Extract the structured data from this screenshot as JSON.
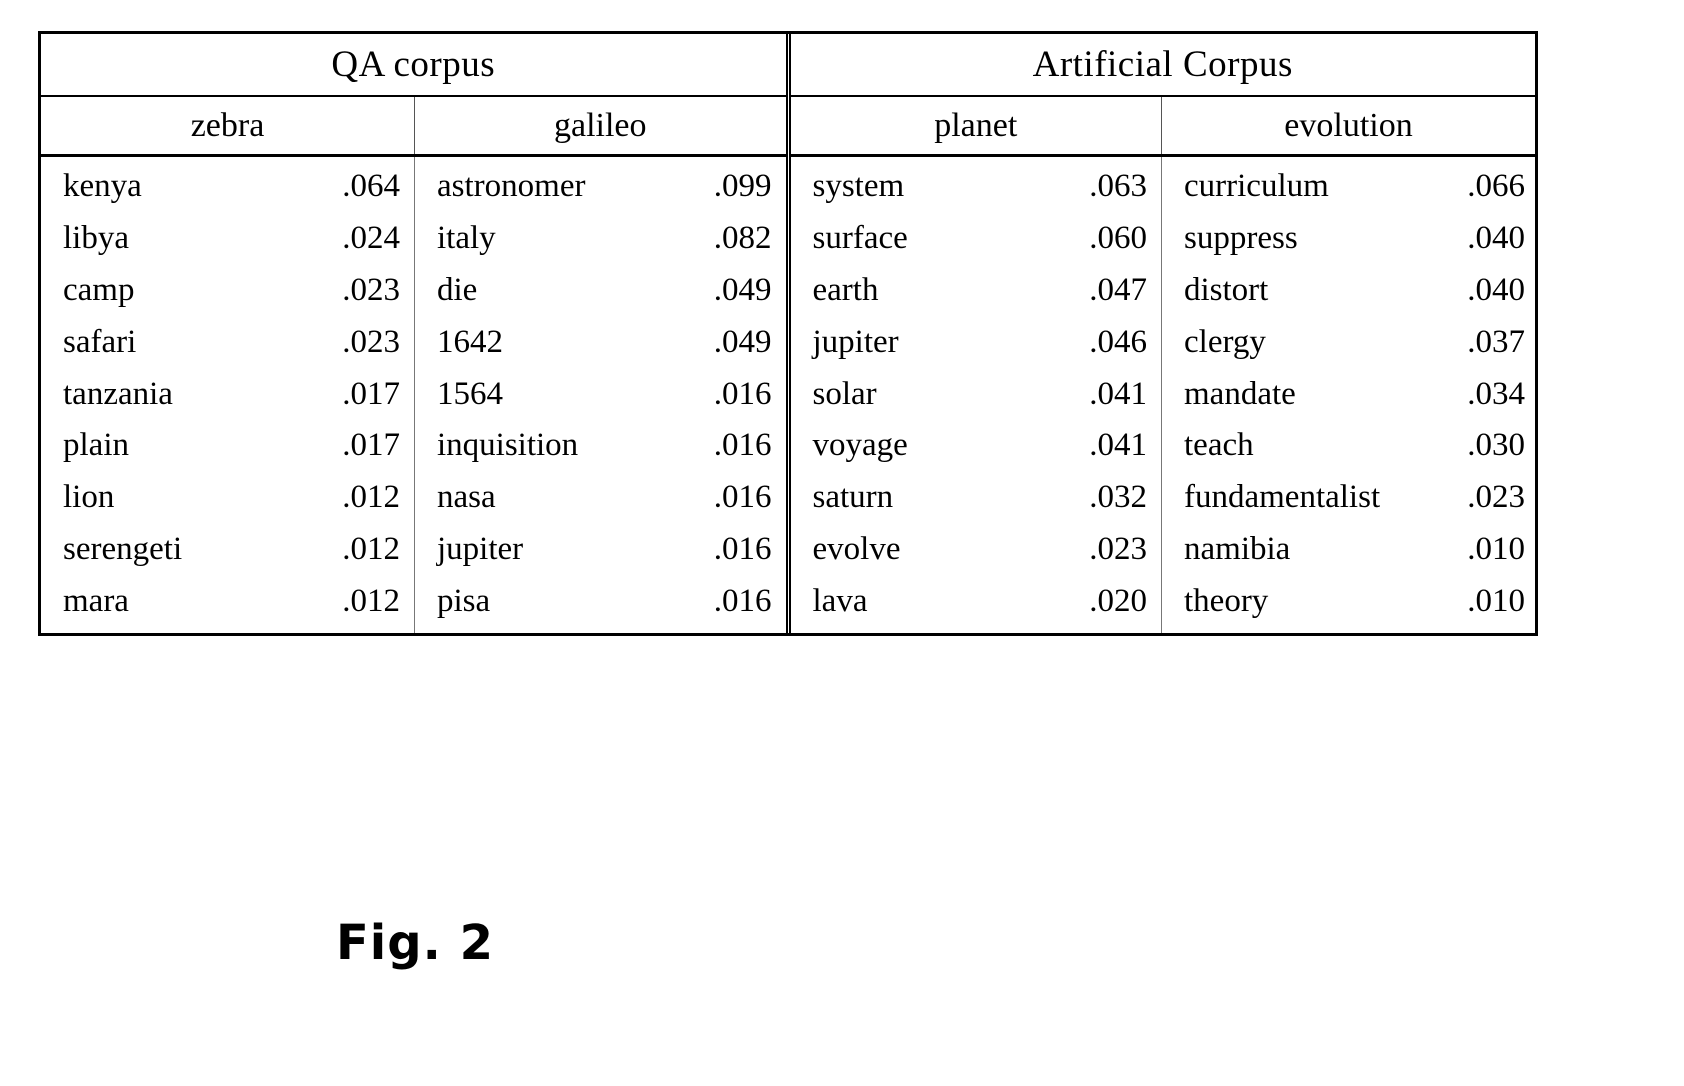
{
  "figure": {
    "caption": "Fig. 2"
  },
  "table": {
    "corpora": [
      {
        "id": "qa-corpus",
        "label": "QA corpus"
      },
      {
        "id": "artificial-corpus",
        "label": "Artificial Corpus"
      }
    ],
    "columns": [
      {
        "id": "zebra",
        "header": "zebra"
      },
      {
        "id": "galileo",
        "header": "galileo"
      },
      {
        "id": "planet",
        "header": "planet"
      },
      {
        "id": "evolution",
        "header": "evolution"
      }
    ],
    "data": {
      "zebra": [
        {
          "word": "kenya",
          "score": ".064"
        },
        {
          "word": "libya",
          "score": ".024"
        },
        {
          "word": "camp",
          "score": ".023"
        },
        {
          "word": "safari",
          "score": ".023"
        },
        {
          "word": "tanzania",
          "score": ".017"
        },
        {
          "word": "plain",
          "score": ".017"
        },
        {
          "word": "lion",
          "score": ".012"
        },
        {
          "word": "serengeti",
          "score": ".012"
        },
        {
          "word": "mara",
          "score": ".012"
        }
      ],
      "galileo": [
        {
          "word": "astronomer",
          "score": ".099"
        },
        {
          "word": "italy",
          "score": ".082"
        },
        {
          "word": "die",
          "score": ".049"
        },
        {
          "word": "1642",
          "score": ".049"
        },
        {
          "word": "1564",
          "score": ".016"
        },
        {
          "word": "inquisition",
          "score": ".016"
        },
        {
          "word": "nasa",
          "score": ".016"
        },
        {
          "word": "jupiter",
          "score": ".016"
        },
        {
          "word": "pisa",
          "score": ".016"
        }
      ],
      "planet": [
        {
          "word": "system",
          "score": ".063"
        },
        {
          "word": "surface",
          "score": ".060"
        },
        {
          "word": "earth",
          "score": ".047"
        },
        {
          "word": "jupiter",
          "score": ".046"
        },
        {
          "word": "solar",
          "score": ".041"
        },
        {
          "word": "voyage",
          "score": ".041"
        },
        {
          "word": "saturn",
          "score": ".032"
        },
        {
          "word": "evolve",
          "score": ".023"
        },
        {
          "word": "lava",
          "score": ".020"
        }
      ],
      "evolution": [
        {
          "word": "curriculum",
          "score": ".066"
        },
        {
          "word": "suppress",
          "score": ".040"
        },
        {
          "word": "distort",
          "score": ".040"
        },
        {
          "word": "clergy",
          "score": ".037"
        },
        {
          "word": "mandate",
          "score": ".034"
        },
        {
          "word": "teach",
          "score": ".030"
        },
        {
          "word": "fundamentalist",
          "score": ".023"
        },
        {
          "word": "namibia",
          "score": ".010"
        },
        {
          "word": "theory",
          "score": ".010"
        }
      ]
    }
  }
}
